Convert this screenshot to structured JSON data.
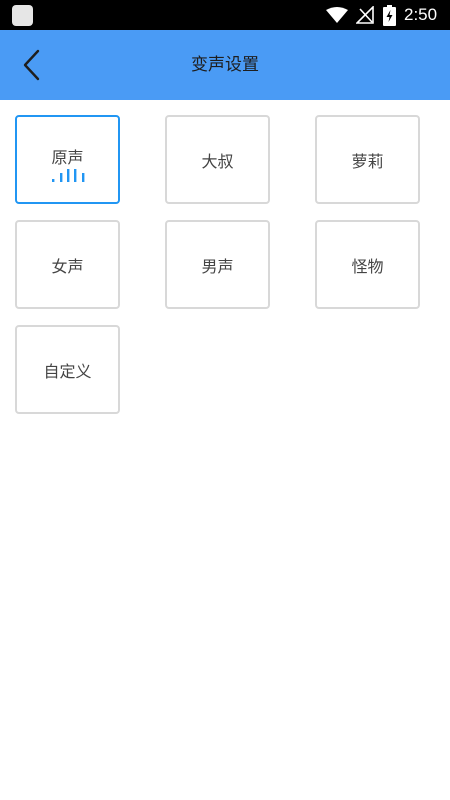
{
  "status_bar": {
    "time": "2:50",
    "icons": [
      "app-notification-icon",
      "wifi-icon",
      "no-signal-icon",
      "battery-charging-icon"
    ]
  },
  "header": {
    "title": "变声设置",
    "back_icon": "chevron-left-icon"
  },
  "colors": {
    "header_bg": "#4a9bf5",
    "selected_border": "#2196f3",
    "card_border": "#d8d8d8",
    "wave": "#2196f3"
  },
  "voices": [
    {
      "label": "原声",
      "selected": true,
      "indicator_icon": "sound-wave-icon"
    },
    {
      "label": "大叔",
      "selected": false
    },
    {
      "label": "萝莉",
      "selected": false
    },
    {
      "label": "女声",
      "selected": false
    },
    {
      "label": "男声",
      "selected": false
    },
    {
      "label": "怪物",
      "selected": false
    },
    {
      "label": "自定义",
      "selected": false
    }
  ]
}
